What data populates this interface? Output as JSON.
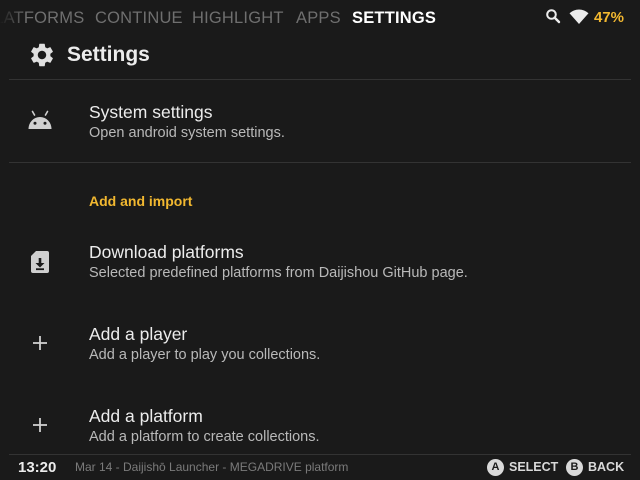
{
  "tabs": [
    {
      "label": "PLATFORMS",
      "active": false
    },
    {
      "label": "CONTINUE",
      "active": false
    },
    {
      "label": "HIGHLIGHT",
      "active": false
    },
    {
      "label": "APPS",
      "active": false
    },
    {
      "label": "SETTINGS",
      "active": true
    }
  ],
  "status_bar": {
    "icons": [
      "search-icon",
      "wifi-icon"
    ],
    "battery": "47%",
    "battery_color": "#f2b830"
  },
  "header": {
    "icon": "gear-icon",
    "title": "Settings"
  },
  "items": [
    {
      "icon": "android-icon",
      "title": "System settings",
      "subtitle": "Open android system settings."
    },
    {
      "icon": "download-file-icon",
      "title": "Download platforms",
      "subtitle": "Selected predefined platforms from Daijishou GitHub page."
    },
    {
      "icon": "plus-icon",
      "title": "Add a player",
      "subtitle": "Add a player to play you collections."
    },
    {
      "icon": "plus-icon",
      "title": "Add a platform",
      "subtitle": "Add a platform to create collections."
    }
  ],
  "section": {
    "label": "Add and import",
    "color": "#f2b830"
  },
  "bottom_bar": {
    "time": "13:20",
    "status": "Mar 14 - Daijishō Launcher - MEGADRIVE platform",
    "hints": [
      {
        "button": "A",
        "label": "SELECT"
      },
      {
        "button": "B",
        "label": "BACK"
      }
    ]
  },
  "colors": {
    "background": "#1a1a1a",
    "accent": "#f2b830",
    "text_primary": "#ececec",
    "text_secondary": "#b9b9b9",
    "tab_inactive": "#6f6f6f"
  }
}
